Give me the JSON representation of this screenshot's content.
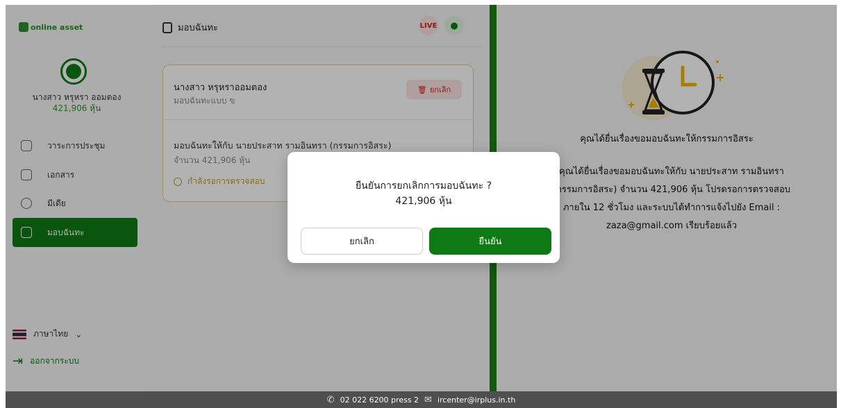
{
  "brand": {
    "logo_text": "online asset",
    "accent": "#0f7a14",
    "live_color": "#d61f1f",
    "pending_color": "#c79a1c"
  },
  "sidebar": {
    "user_name": "นางสาว หรุหรา ออมตอง",
    "user_shares": "421,906 หุ้น",
    "items": [
      {
        "label": "วาระการประชุม",
        "icon": "agenda-icon",
        "active": false
      },
      {
        "label": "เอกสาร",
        "icon": "folder-icon",
        "active": false
      },
      {
        "label": "มีเดีย",
        "icon": "play-icon",
        "active": false
      },
      {
        "label": "มอบฉันทะ",
        "icon": "proxy-icon",
        "active": true
      }
    ],
    "language_label": "ภาษาไทย",
    "logout_label": "ออกจากระบบ"
  },
  "middle": {
    "title": "มอบฉันทะ",
    "live_label": "LIVE",
    "card": {
      "name": "นางสาว หรุหราออมตอง",
      "type": "มอบฉันทะแบบ ข",
      "cancel_label": "ยกเลิก",
      "to_text": "มอบฉันทะให้กับ นายประสาท รามอินทรา (กรรมการอิสระ)",
      "amount_text": "จำนวน 421,906 หุ้น",
      "status_text": "กำลังรอการตรวจสอบ"
    }
  },
  "right": {
    "title": "คุณได้ยื่นเรื่องขอมอบฉันทะให้กรรมการอิสระ",
    "detail": "คุณได้ยื่นเรื่องขอมอบฉันทะให้กับ นายประสาท รามอินทรา (กรรมการอิสระ) จำนวน 421,906 หุ้น โปรดรอการตรวจสอบภายใน 12 ชั่วโมง และระบบได้ทำการแจ้งไปยัง Email : zaza@gmail.com เรียบร้อยแล้ว"
  },
  "modal": {
    "question": "ยืนยันการยกเลิกการมอบฉันทะ ?",
    "amount": "421,906 หุ้น",
    "cancel_label": "ยกเลิก",
    "confirm_label": "ยืนยัน"
  },
  "footer": {
    "phone": "02 022 6200 press 2",
    "email": "ircenter@irplus.in.th"
  }
}
